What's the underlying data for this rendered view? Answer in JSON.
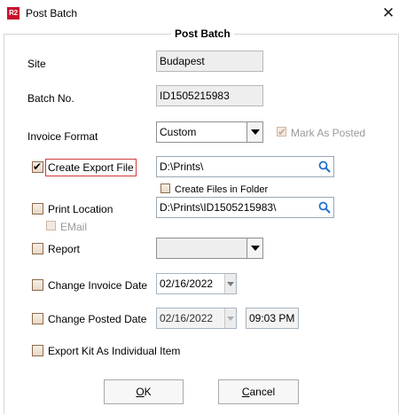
{
  "window": {
    "title": "Post Batch",
    "logo_text": "R2",
    "close_glyph": "✕"
  },
  "group": {
    "title": "Post Batch"
  },
  "site": {
    "label": "Site",
    "value": "Budapest"
  },
  "batch": {
    "label": "Batch No.",
    "value": "ID1505215983"
  },
  "invoice_format": {
    "label": "Invoice Format",
    "value": "Custom"
  },
  "mark_as_posted": {
    "label": "Mark As Posted",
    "checked": true,
    "enabled": false
  },
  "create_export_file": {
    "label": "Create Export File",
    "checked": true,
    "path": "D:\\Prints\\"
  },
  "create_files_in_folder": {
    "label": "Create Files in Folder",
    "checked": false
  },
  "print_location": {
    "label": "Print Location",
    "checked": false,
    "path": "D:\\Prints\\ID1505215983\\"
  },
  "email": {
    "label": "EMail",
    "checked": false,
    "enabled": false
  },
  "report": {
    "label": "Report",
    "checked": false,
    "value": ""
  },
  "change_invoice_date": {
    "label": "Change Invoice Date",
    "checked": false,
    "date": "02/16/2022"
  },
  "change_posted_date": {
    "label": "Change Posted Date",
    "checked": false,
    "date": "02/16/2022",
    "time": "09:03 PM"
  },
  "export_kit": {
    "label": "Export Kit As Individual Item",
    "checked": false
  },
  "buttons": {
    "ok": {
      "hotkey": "O",
      "rest": "K"
    },
    "cancel": {
      "hotkey": "C",
      "rest": "ancel"
    }
  },
  "colors": {
    "logo": "#c8102e",
    "focus_border": "#d23a3a",
    "search_icon": "#1e6fd0"
  }
}
